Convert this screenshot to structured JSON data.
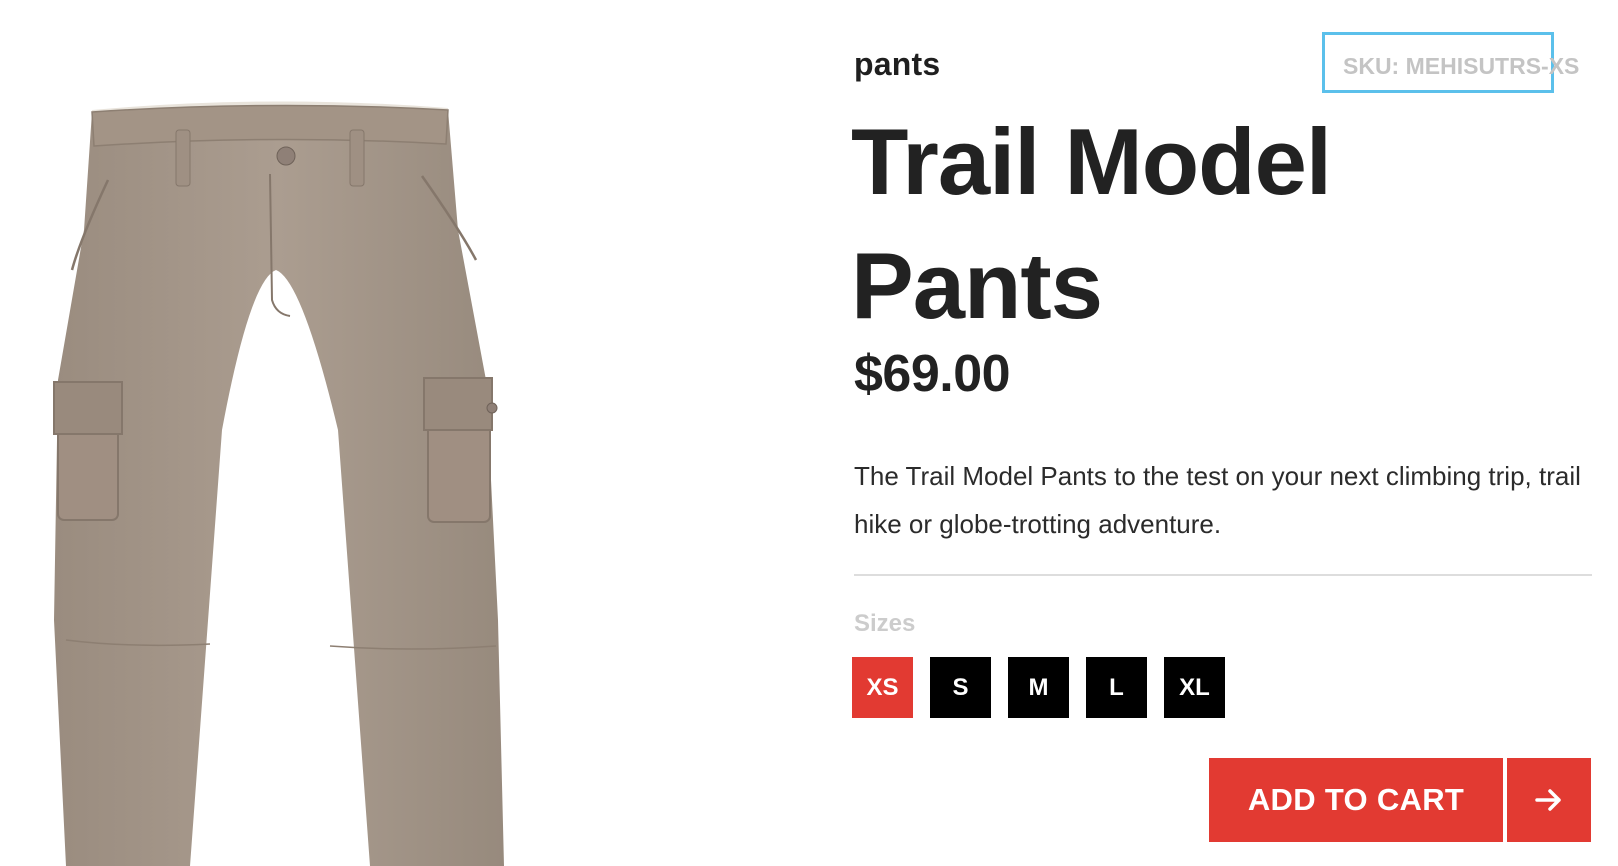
{
  "product": {
    "category": "pants",
    "sku": "SKU: MEHISUTRS-XS",
    "title": "Trail Model Pants",
    "price": "$69.00",
    "description": "The Trail Model Pants to the test on your next climbing trip, trail hike or globe-trotting adventure.",
    "image_icon": "pants-image"
  },
  "sizes": {
    "label": "Sizes",
    "options": [
      "XS",
      "S",
      "M",
      "L",
      "XL"
    ],
    "selected": "XS"
  },
  "cart": {
    "button_label": "ADD TO CART",
    "arrow_icon": "arrow-right-icon"
  },
  "colors": {
    "accent": "#e23a32",
    "size_default": "#000000",
    "sku_highlight": "#5bc0eb",
    "pants_fabric": "#a5978a"
  }
}
